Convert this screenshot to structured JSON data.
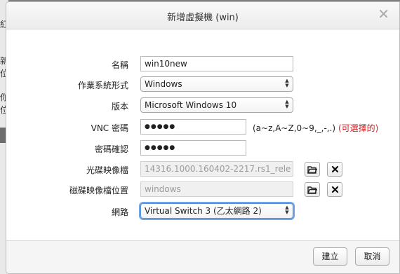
{
  "background": {
    "glyphs": [
      "紅",
      "新",
      "位",
      "你",
      "位"
    ]
  },
  "dialog": {
    "title": "新增虛擬機 (win)",
    "close_glyph": "✕"
  },
  "form": {
    "name": {
      "label": "名稱",
      "value": "win10new"
    },
    "os_type": {
      "label": "作業系統形式",
      "value": "Windows"
    },
    "version": {
      "label": "版本",
      "value": "Microsoft Windows 10"
    },
    "vnc_password": {
      "label": "VNC 密碼",
      "value": "●●●●●",
      "hint": "(a~z,A~Z,0~9,_,-,.)",
      "optional": "(可選擇的)"
    },
    "password_confirm": {
      "label": "密碼確認",
      "value": "●●●●●"
    },
    "cd_image": {
      "label": "光碟映像檔",
      "value": "14316.1000.160402-2217.rs1_rele"
    },
    "disk_image_location": {
      "label": "磁碟映像檔位置",
      "value": "windows"
    },
    "network": {
      "label": "網路",
      "value": "Virtual Switch 3 (乙太網路 2)"
    }
  },
  "footer": {
    "create_label": "建立",
    "cancel_label": "取消"
  }
}
